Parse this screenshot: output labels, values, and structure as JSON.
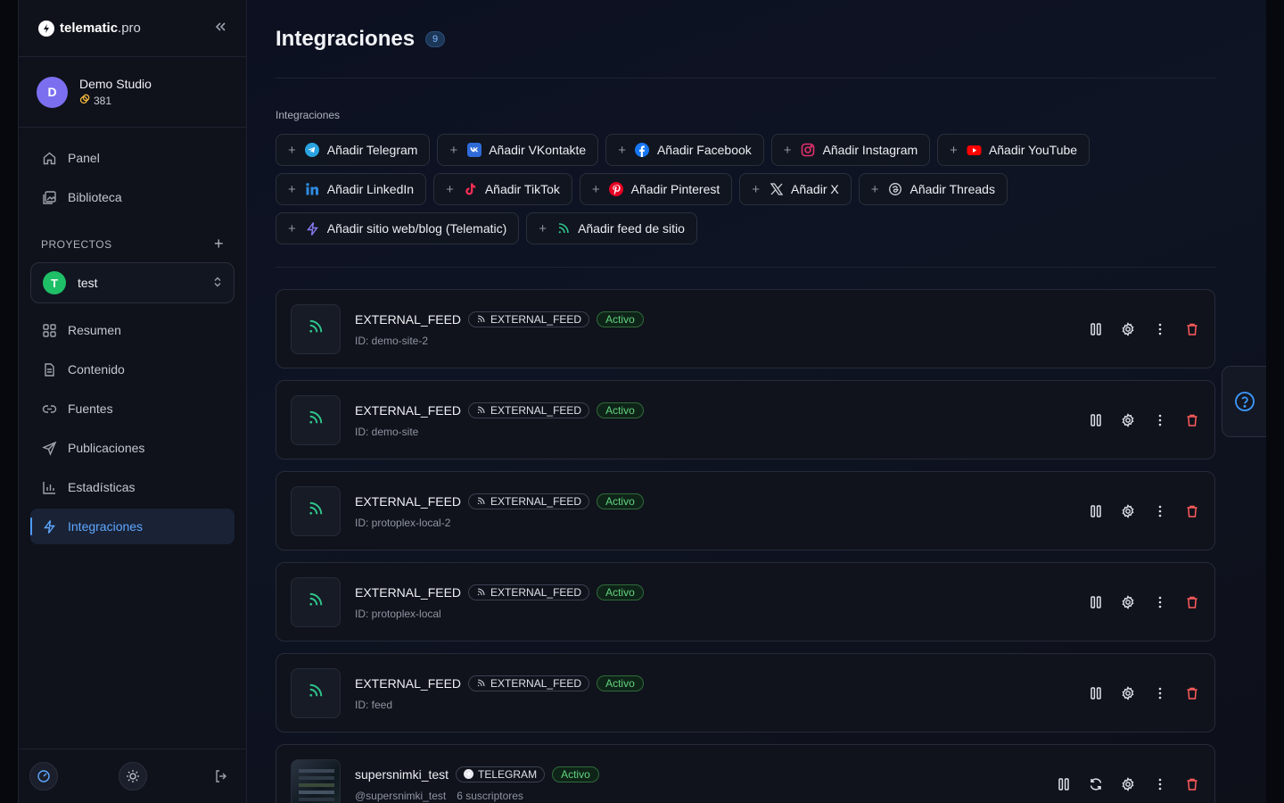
{
  "brand": {
    "name_bold": "telematic",
    "name_light": ".pro"
  },
  "studio": {
    "name": "Demo Studio",
    "credits": "381"
  },
  "nav_top": [
    {
      "label": "Panel",
      "icon": "home-icon"
    },
    {
      "label": "Biblioteca",
      "icon": "image-icon"
    }
  ],
  "projects": {
    "heading": "PROYECTOS",
    "selected_initial": "T",
    "selected_name": "test"
  },
  "nav_project": [
    {
      "label": "Resumen",
      "icon": "grid-icon"
    },
    {
      "label": "Contenido",
      "icon": "document-icon"
    },
    {
      "label": "Fuentes",
      "icon": "link-icon"
    },
    {
      "label": "Publicaciones",
      "icon": "send-icon"
    },
    {
      "label": "Estadísticas",
      "icon": "bar-chart-icon"
    },
    {
      "label": "Integraciones",
      "icon": "lightning-icon",
      "active": true
    }
  ],
  "page": {
    "title": "Integraciones",
    "count": "9",
    "section_label": "Integraciones"
  },
  "add_buttons": [
    {
      "label": "Añadir Telegram",
      "icon": "telegram-icon",
      "color": "#2aa3e0"
    },
    {
      "label": "Añadir VKontakte",
      "icon": "vk-icon",
      "color": "#2e6bd8"
    },
    {
      "label": "Añadir Facebook",
      "icon": "facebook-icon",
      "color": "#1877f2"
    },
    {
      "label": "Añadir Instagram",
      "icon": "instagram-icon",
      "color": "#e1306c"
    },
    {
      "label": "Añadir YouTube",
      "icon": "youtube-icon",
      "color": "#ff0000"
    },
    {
      "label": "Añadir LinkedIn",
      "icon": "linkedin-icon",
      "color": "#2f8ae0"
    },
    {
      "label": "Añadir TikTok",
      "icon": "tiktok-icon",
      "color": "#ff2e55"
    },
    {
      "label": "Añadir Pinterest",
      "icon": "pinterest-icon",
      "color": "#e60023"
    },
    {
      "label": "Añadir X",
      "icon": "x-icon",
      "color": "#d0d3da"
    },
    {
      "label": "Añadir Threads",
      "icon": "threads-icon",
      "color": "#d0d3da"
    },
    {
      "label": "Añadir sitio web/blog (Telematic)",
      "icon": "lightning-icon",
      "color": "#8b7cf6"
    },
    {
      "label": "Añadir feed de sitio",
      "icon": "rss-icon",
      "color": "#2fc48a"
    }
  ],
  "integrations": [
    {
      "name": "EXTERNAL_FEED",
      "type": "EXTERNAL_FEED",
      "type_icon": "rss-icon",
      "status": "Activo",
      "sub": [
        "ID: demo-site-2"
      ],
      "thumb": "rss",
      "actions": [
        "pause",
        "settings",
        "more",
        "delete"
      ]
    },
    {
      "name": "EXTERNAL_FEED",
      "type": "EXTERNAL_FEED",
      "type_icon": "rss-icon",
      "status": "Activo",
      "sub": [
        "ID: demo-site"
      ],
      "thumb": "rss",
      "actions": [
        "pause",
        "settings",
        "more",
        "delete"
      ]
    },
    {
      "name": "EXTERNAL_FEED",
      "type": "EXTERNAL_FEED",
      "type_icon": "rss-icon",
      "status": "Activo",
      "sub": [
        "ID: protoplex-local-2"
      ],
      "thumb": "rss",
      "actions": [
        "pause",
        "settings",
        "more",
        "delete"
      ]
    },
    {
      "name": "EXTERNAL_FEED",
      "type": "EXTERNAL_FEED",
      "type_icon": "rss-icon",
      "status": "Activo",
      "sub": [
        "ID: protoplex-local"
      ],
      "thumb": "rss",
      "actions": [
        "pause",
        "settings",
        "more",
        "delete"
      ]
    },
    {
      "name": "EXTERNAL_FEED",
      "type": "EXTERNAL_FEED",
      "type_icon": "rss-icon",
      "status": "Activo",
      "sub": [
        "ID: feed"
      ],
      "thumb": "rss",
      "actions": [
        "pause",
        "settings",
        "more",
        "delete"
      ]
    },
    {
      "name": "supersnimki_test",
      "type": "TELEGRAM",
      "type_icon": "telegram-icon",
      "status": "Activo",
      "sub": [
        "@supersnimki_test",
        "6 suscriptores"
      ],
      "thumb": "image",
      "actions": [
        "pause",
        "refresh",
        "settings",
        "more",
        "delete"
      ]
    }
  ]
}
